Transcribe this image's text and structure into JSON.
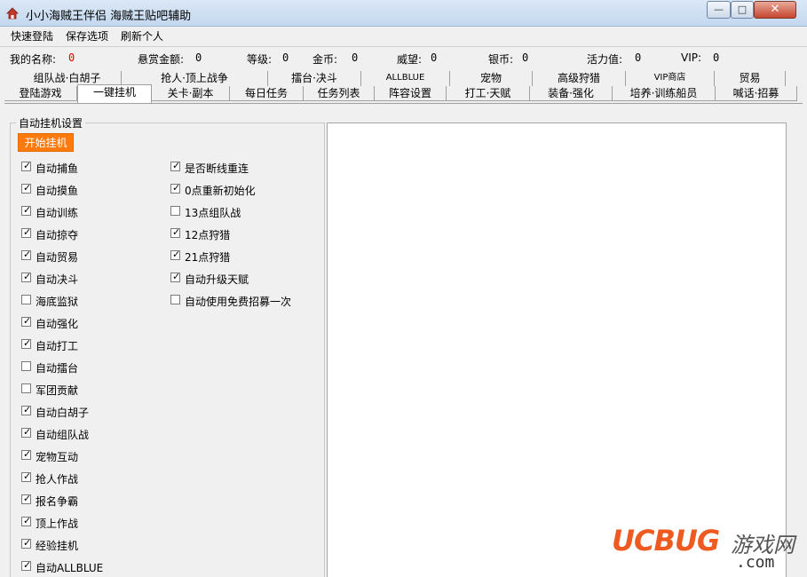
{
  "window": {
    "title": "小小海贼王伴侣 海贼王贴吧辅助",
    "minimize": "—",
    "maximize": "□",
    "close": "✕"
  },
  "menu": [
    "快速登陆",
    "保存选项",
    "刷新个人"
  ],
  "info": [
    {
      "label": "我的名称:",
      "value": "0"
    },
    {
      "label": "悬赏金额:",
      "value": "0"
    },
    {
      "label": "等级:",
      "value": "0"
    },
    {
      "label": "金币:",
      "value": "0"
    },
    {
      "label": "威望:",
      "value": "0"
    },
    {
      "label": "银币:",
      "value": "0"
    },
    {
      "label": "活力值:",
      "value": "0"
    },
    {
      "label": "VIP:",
      "value": "0"
    }
  ],
  "tabs_row1": [
    "组队战·白胡子",
    "抢人·顶上战争",
    "擂台·决斗",
    "ALLBLUE",
    "宠物",
    "高级狩猎",
    "VIP商店",
    "贸易"
  ],
  "tabs_row2": [
    "登陆游戏",
    "一键挂机",
    "关卡·副本",
    "每日任务",
    "任务列表",
    "阵容设置",
    "打工·天赋",
    "装备·强化",
    "培养·训练船员",
    "喊话·招募"
  ],
  "active_tab": "一键挂机",
  "panel": {
    "group_title": "自动挂机设置",
    "start_button": "开始挂机",
    "left_options": [
      {
        "label": "自动捕鱼",
        "checked": true
      },
      {
        "label": "自动摸鱼",
        "checked": true
      },
      {
        "label": "自动训练",
        "checked": true
      },
      {
        "label": "自动掠夺",
        "checked": true
      },
      {
        "label": "自动贸易",
        "checked": true
      },
      {
        "label": "自动决斗",
        "checked": true
      },
      {
        "label": "海底监狱",
        "checked": false
      },
      {
        "label": "自动强化",
        "checked": true
      },
      {
        "label": "自动打工",
        "checked": true
      },
      {
        "label": "自动擂台",
        "checked": false
      },
      {
        "label": "军团贡献",
        "checked": false
      },
      {
        "label": "自动白胡子",
        "checked": true
      },
      {
        "label": "自动组队战",
        "checked": true
      },
      {
        "label": "宠物互动",
        "checked": true
      },
      {
        "label": "抢人作战",
        "checked": true
      },
      {
        "label": "报名争霸",
        "checked": true
      },
      {
        "label": "顶上作战",
        "checked": true
      },
      {
        "label": "经验挂机",
        "checked": true
      },
      {
        "label": "自动ALLBLUE",
        "checked": true
      }
    ],
    "right_options": [
      {
        "label": "是否断线重连",
        "checked": true
      },
      {
        "label": "0点重新初始化",
        "checked": true
      },
      {
        "label": "13点组队战",
        "checked": false
      },
      {
        "label": "12点狩猎",
        "checked": true
      },
      {
        "label": "21点狩猎",
        "checked": true
      },
      {
        "label": "自动升级天赋",
        "checked": true
      },
      {
        "label": "自动使用免费招募一次",
        "checked": false
      }
    ]
  },
  "watermark": {
    "brand": "UCBUG",
    "cn": "游戏网",
    "domain": ".com"
  },
  "colors": {
    "start_button": "#ff7a0d",
    "red_value": "#e00000",
    "watermark": "#ee5a1f"
  }
}
